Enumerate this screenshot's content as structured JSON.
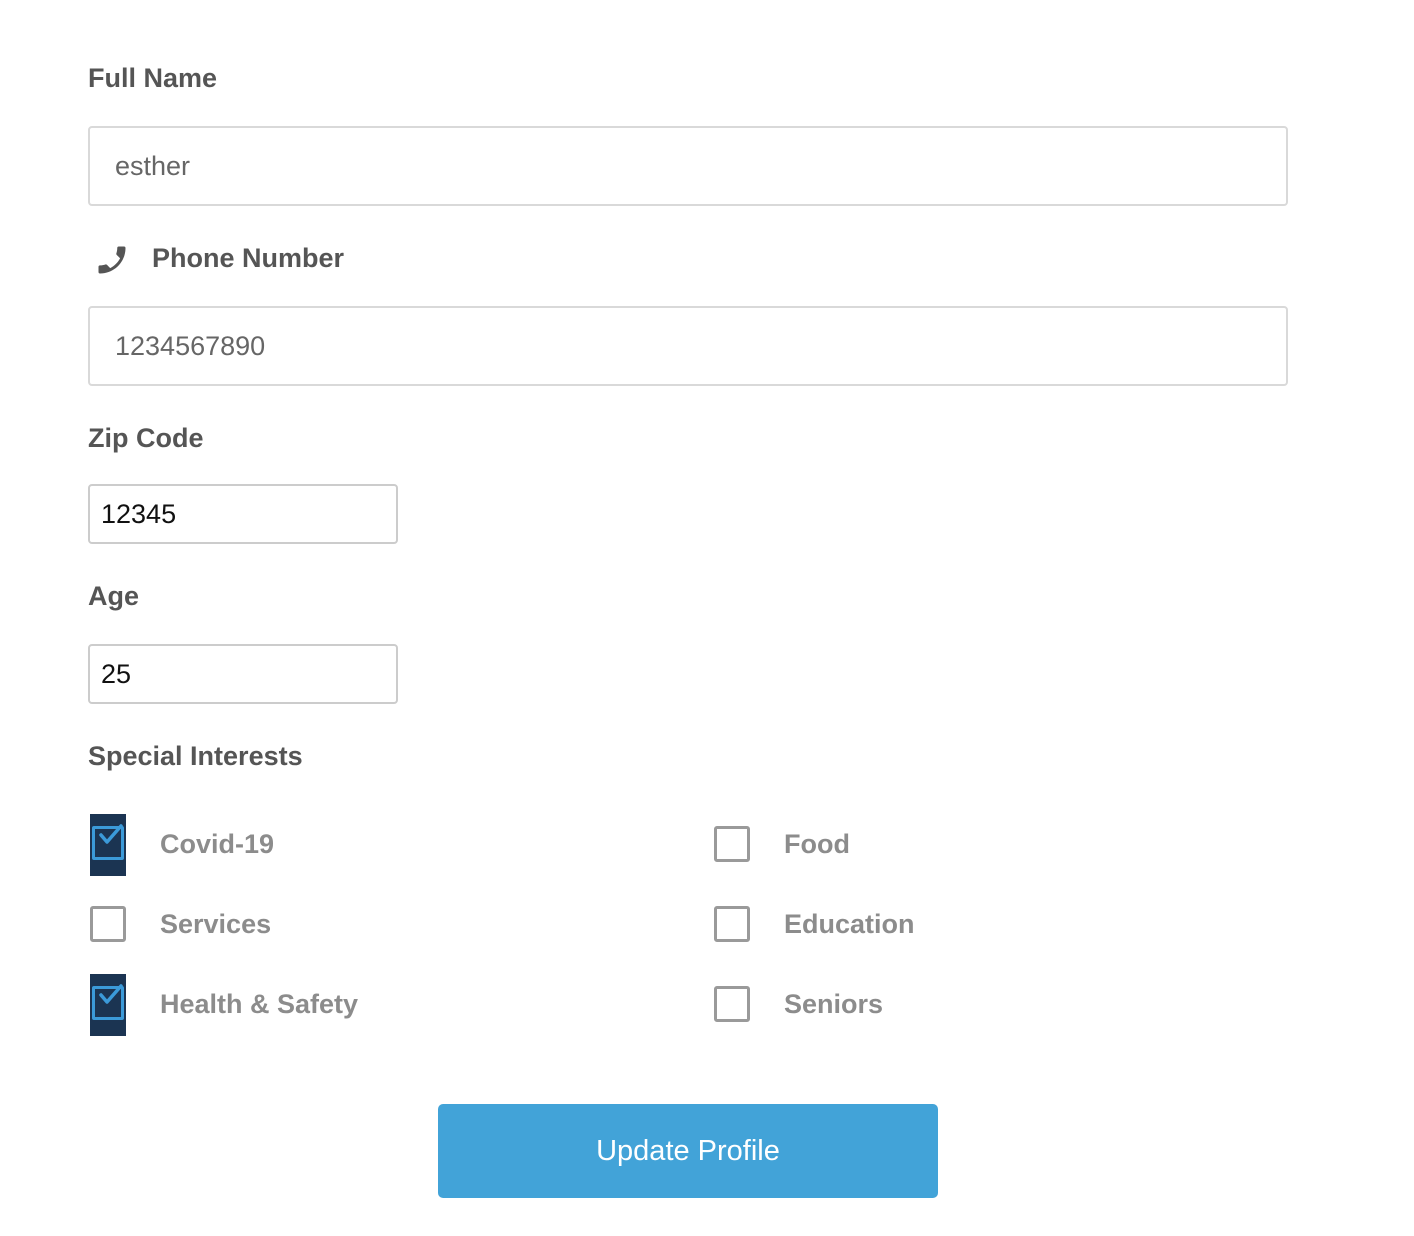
{
  "form": {
    "full_name": {
      "label": "Full Name",
      "value": "esther"
    },
    "phone": {
      "label": "Phone Number",
      "icon": "phone-icon",
      "value": "1234567890"
    },
    "zip": {
      "label": "Zip Code",
      "value": "12345"
    },
    "age": {
      "label": "Age",
      "value": "25"
    },
    "interests": {
      "label": "Special Interests",
      "options": [
        {
          "label": "Covid-19",
          "checked": true
        },
        {
          "label": "Food",
          "checked": false
        },
        {
          "label": "Services",
          "checked": false
        },
        {
          "label": "Education",
          "checked": false
        },
        {
          "label": "Health & Safety",
          "checked": true
        },
        {
          "label": "Seniors",
          "checked": false
        }
      ]
    },
    "submit_label": "Update Profile"
  },
  "colors": {
    "accent": "#42a3d8",
    "checked_bg": "#1b3452",
    "check_color": "#3b9ad9"
  }
}
